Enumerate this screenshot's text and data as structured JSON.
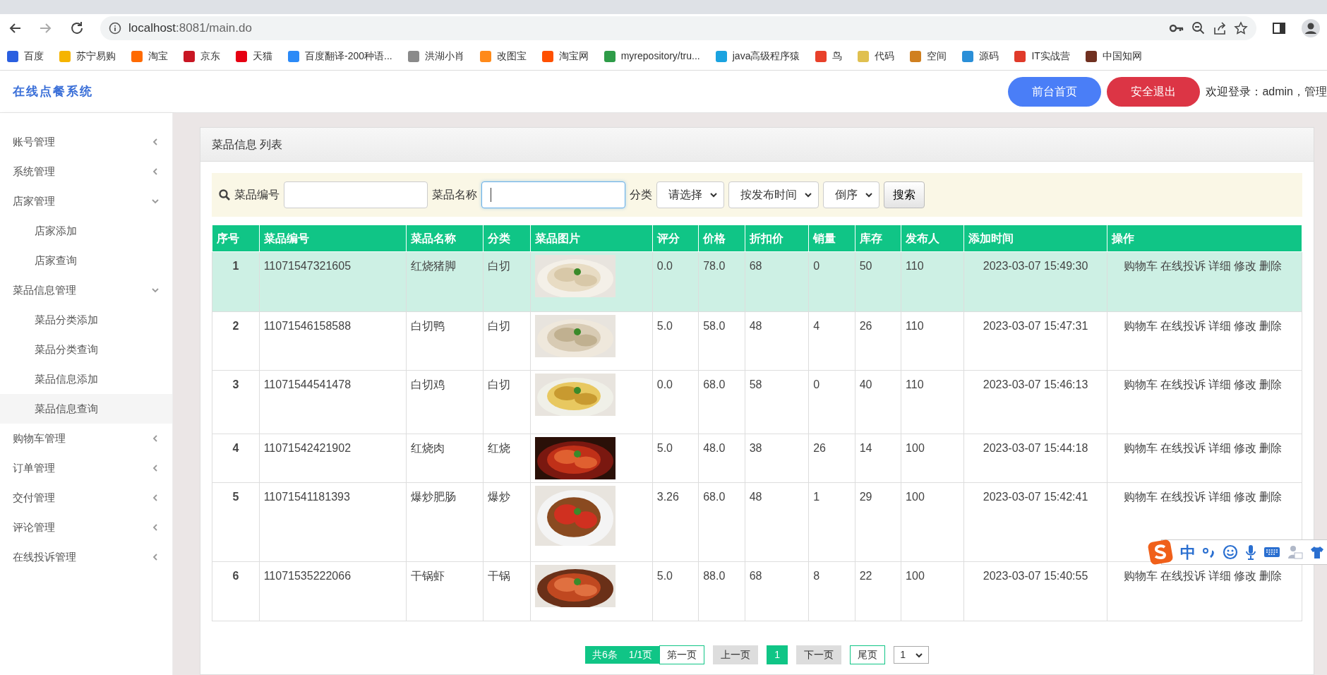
{
  "browser": {
    "url_host": "localhost",
    "url_rest": ":8081/main.do",
    "bookmarks": [
      {
        "label": "百度",
        "color": "#2a5fe0"
      },
      {
        "label": "苏宁易购",
        "color": "#f5b400"
      },
      {
        "label": "淘宝",
        "color": "#ff6a00"
      },
      {
        "label": "京东",
        "color": "#c81623"
      },
      {
        "label": "天猫",
        "color": "#e60012"
      },
      {
        "label": "百度翻译-200种语...",
        "color": "#2b8af7"
      },
      {
        "label": "洪湖小肖",
        "color": "#8a8a8a"
      },
      {
        "label": "改图宝",
        "color": "#ff8a1a"
      },
      {
        "label": "淘宝网",
        "color": "#ff5000"
      },
      {
        "label": "myrepository/tru...",
        "color": "#2e9c48"
      },
      {
        "label": "java高级程序猿",
        "color": "#1aa3e0"
      },
      {
        "label": "鸟",
        "color": "#e8402a"
      },
      {
        "label": "代码",
        "color": "#e0c050"
      },
      {
        "label": "空间",
        "color": "#d08020"
      },
      {
        "label": "源码",
        "color": "#2a8fd8"
      },
      {
        "label": "IT实战营",
        "color": "#e03a2a"
      },
      {
        "label": "中国知网",
        "color": "#703020"
      }
    ]
  },
  "app": {
    "brand": "在线点餐系统",
    "buttons": [
      {
        "label": "前台首页",
        "kind": "primary"
      },
      {
        "label": "安全退出",
        "kind": "danger"
      }
    ],
    "welcome": "欢迎登录：admin，管理"
  },
  "sidebar": {
    "items": [
      {
        "label": "账号管理",
        "expanded": false
      },
      {
        "label": "系统管理",
        "expanded": false
      },
      {
        "label": "店家管理",
        "expanded": true,
        "children": [
          {
            "label": "店家添加",
            "selected": false
          },
          {
            "label": "店家查询",
            "selected": false
          }
        ]
      },
      {
        "label": "菜品信息管理",
        "expanded": true,
        "children": [
          {
            "label": "菜品分类添加",
            "selected": false
          },
          {
            "label": "菜品分类查询",
            "selected": false
          },
          {
            "label": "菜品信息添加",
            "selected": false
          },
          {
            "label": "菜品信息查询",
            "selected": true
          }
        ]
      },
      {
        "label": "购物车管理",
        "expanded": false
      },
      {
        "label": "订单管理",
        "expanded": false
      },
      {
        "label": "交付管理",
        "expanded": false
      },
      {
        "label": "评论管理",
        "expanded": false
      },
      {
        "label": "在线投诉管理",
        "expanded": false
      }
    ]
  },
  "panel": {
    "title": "菜品信息 列表",
    "search": {
      "fields": [
        {
          "label": "菜品编号",
          "focused": false
        },
        {
          "label": "菜品名称",
          "focused": true
        }
      ],
      "category_label": "分类",
      "selects": [
        {
          "value": "请选择"
        },
        {
          "value": "按发布时间"
        },
        {
          "value": "倒序"
        }
      ],
      "button": "搜索"
    },
    "table": {
      "columns": [
        "序号",
        "菜品编号",
        "菜品名称",
        "分类",
        "菜品图片",
        "评分",
        "价格",
        "折扣价",
        "销量",
        "库存",
        "发布人",
        "添加时间",
        "操作"
      ],
      "rows": [
        {
          "selected": true,
          "cells": [
            "1",
            "11071547321605",
            "红烧猪脚",
            "白切",
            "",
            "0.0",
            "78.0",
            "68",
            "0",
            "50",
            "110",
            "2023-03-07 15:49:30"
          ],
          "actions": [
            "购物车",
            "在线投诉",
            "详细",
            "修改",
            "删除"
          ]
        },
        {
          "selected": false,
          "cells": [
            "2",
            "11071546158588",
            "白切鸭",
            "白切",
            "",
            "5.0",
            "58.0",
            "48",
            "4",
            "26",
            "110",
            "2023-03-07 15:47:31"
          ],
          "actions": [
            "购物车",
            "在线投诉",
            "详细",
            "修改",
            "删除"
          ]
        },
        {
          "selected": false,
          "cells": [
            "3",
            "11071544541478",
            "白切鸡",
            "白切",
            "",
            "0.0",
            "68.0",
            "58",
            "0",
            "40",
            "110",
            "2023-03-07 15:46:13"
          ],
          "actions": [
            "购物车",
            "在线投诉",
            "详细",
            "修改",
            "删除"
          ]
        },
        {
          "selected": false,
          "cells": [
            "4",
            "11071542421902",
            "红烧肉",
            "红烧",
            "",
            "5.0",
            "48.0",
            "38",
            "26",
            "14",
            "100",
            "2023-03-07 15:44:18"
          ],
          "actions": [
            "购物车",
            "在线投诉",
            "详细",
            "修改",
            "删除"
          ]
        },
        {
          "selected": false,
          "cells": [
            "5",
            "11071541181393",
            "爆炒肥肠",
            "爆炒",
            "",
            "3.26",
            "68.0",
            "48",
            "1",
            "29",
            "100",
            "2023-03-07 15:42:41"
          ],
          "actions": [
            "购物车",
            "在线投诉",
            "详细",
            "修改",
            "删除"
          ]
        },
        {
          "selected": false,
          "cells": [
            "6",
            "11071535222066",
            "干锅虾",
            "干锅",
            "",
            "5.0",
            "88.0",
            "68",
            "8",
            "22",
            "100",
            "2023-03-07 15:40:55"
          ],
          "actions": [
            "购物车",
            "在线投诉",
            "详细",
            "修改",
            "删除"
          ]
        }
      ]
    },
    "pagination": {
      "summary": "共6条",
      "pages": "1/1页",
      "items": [
        {
          "label": "第一页",
          "kind": "outline"
        },
        {
          "label": "上一页",
          "kind": "gray"
        },
        {
          "label": "1",
          "kind": "current"
        },
        {
          "label": "下一页",
          "kind": "gray"
        },
        {
          "label": "尾页",
          "kind": "outline"
        }
      ],
      "page_select": "1"
    }
  },
  "ime_toolbar": {
    "mode": "中"
  }
}
